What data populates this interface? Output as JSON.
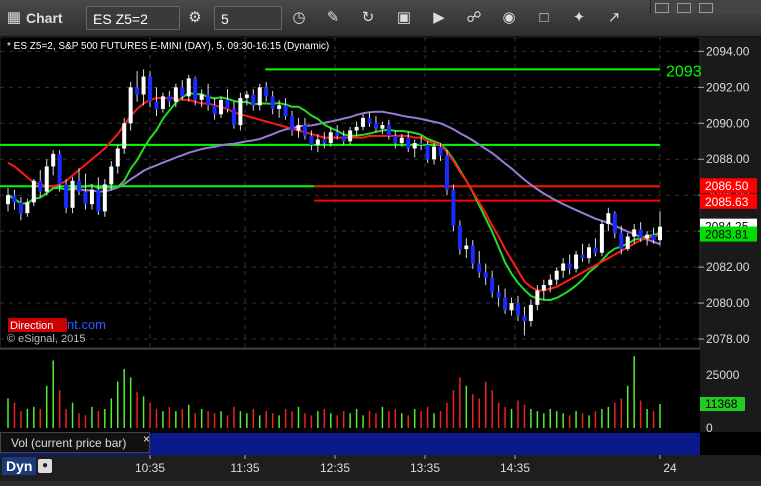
{
  "toolbar": {
    "title": "Chart",
    "symbol": "ES Z5=2",
    "interval": "5",
    "icons": [
      "settings-icon",
      "clock-icon",
      "draw-icon",
      "refresh-icon",
      "quote-icon",
      "play-icon",
      "link-icon",
      "comment-icon",
      "twitter-icon",
      "expand-icon"
    ]
  },
  "chart_data": {
    "type": "candlestick",
    "title": "* ES Z5=2, S&P 500 FUTURES E-MINI (DAY), 5, 09:30-16:15 (Dynamic)",
    "watermark": "© eSignal, 2015",
    "direction_badge": "Direction",
    "direction_badge_suffix": "nt.com",
    "x_tick_labels": [
      "10:35",
      "11:35",
      "12:35",
      "13:35",
      "14:35",
      "24"
    ],
    "y_tick_labels": [
      "2094.00",
      "2092.00",
      "2090.00",
      "2088.00",
      "2086.00",
      "2084.00",
      "2082.00",
      "2080.00",
      "2078.00"
    ],
    "ylim": [
      2077.5,
      2094.8
    ],
    "price_markers": [
      {
        "label": "2093",
        "value": 2093.0,
        "color": "#00ff00"
      },
      {
        "label": "2086.50",
        "value": 2086.5,
        "color": "#ff0000"
      },
      {
        "label": "2085.63",
        "value": 2085.63,
        "color": "#ff0000"
      },
      {
        "label": "2084.25",
        "value": 2084.25,
        "color": "#ffffff"
      },
      {
        "label": "2083.81",
        "value": 2083.81,
        "color": "#00dd00"
      }
    ],
    "horizontal_levels": [
      {
        "value": 2093.0,
        "color": "#00ff00",
        "from": 0.38
      },
      {
        "value": 2088.8,
        "color": "#00ff00",
        "from": 0.0
      },
      {
        "value": 2086.5,
        "color": "#00ff00",
        "from": 0.0
      },
      {
        "value": 2086.5,
        "color": "#ff0000",
        "from": 0.45
      },
      {
        "value": 2085.7,
        "color": "#ff0000",
        "from": 0.45
      }
    ],
    "candles": [
      [
        2085.5,
        2086.4,
        2085.1,
        2086.0
      ],
      [
        2086.0,
        2086.3,
        2085.2,
        2085.6
      ],
      [
        2085.6,
        2085.9,
        2084.6,
        2085.0
      ],
      [
        2085.0,
        2085.8,
        2084.8,
        2085.6
      ],
      [
        2085.6,
        2086.9,
        2085.4,
        2086.8
      ],
      [
        2086.8,
        2087.4,
        2085.9,
        2086.2
      ],
      [
        2086.2,
        2088.0,
        2086.0,
        2087.6
      ],
      [
        2087.6,
        2088.5,
        2087.1,
        2088.3
      ],
      [
        2088.3,
        2088.5,
        2086.2,
        2086.6
      ],
      [
        2086.6,
        2086.9,
        2085.0,
        2085.3
      ],
      [
        2085.3,
        2087.0,
        2085.0,
        2086.8
      ],
      [
        2086.8,
        2087.5,
        2086.0,
        2086.2
      ],
      [
        2086.2,
        2087.2,
        2085.2,
        2085.5
      ],
      [
        2085.5,
        2086.6,
        2085.2,
        2086.3
      ],
      [
        2086.3,
        2087.0,
        2084.9,
        2085.1
      ],
      [
        2085.1,
        2086.9,
        2084.8,
        2086.6
      ],
      [
        2086.6,
        2087.9,
        2086.3,
        2087.6
      ],
      [
        2087.6,
        2088.8,
        2087.2,
        2088.6
      ],
      [
        2088.6,
        2090.3,
        2088.3,
        2090.0
      ],
      [
        2090.0,
        2092.3,
        2089.6,
        2092.0
      ],
      [
        2092.0,
        2092.9,
        2091.2,
        2091.6
      ],
      [
        2091.6,
        2093.0,
        2091.0,
        2092.6
      ],
      [
        2092.6,
        2092.9,
        2090.9,
        2091.2
      ],
      [
        2091.2,
        2092.0,
        2090.4,
        2090.8
      ],
      [
        2090.8,
        2091.7,
        2090.6,
        2091.5
      ],
      [
        2091.5,
        2091.8,
        2090.9,
        2091.2
      ],
      [
        2091.2,
        2092.2,
        2090.9,
        2092.0
      ],
      [
        2092.0,
        2092.4,
        2091.3,
        2091.5
      ],
      [
        2091.5,
        2092.7,
        2091.2,
        2092.5
      ],
      [
        2092.5,
        2092.6,
        2091.0,
        2091.3
      ],
      [
        2091.3,
        2091.9,
        2090.9,
        2091.6
      ],
      [
        2091.6,
        2092.2,
        2090.7,
        2091.0
      ],
      [
        2091.0,
        2091.4,
        2090.2,
        2090.5
      ],
      [
        2090.5,
        2091.5,
        2090.3,
        2091.3
      ],
      [
        2091.3,
        2091.9,
        2090.6,
        2090.8
      ],
      [
        2090.8,
        2091.2,
        2089.7,
        2089.9
      ],
      [
        2089.9,
        2091.7,
        2089.6,
        2091.4
      ],
      [
        2091.4,
        2091.8,
        2091.0,
        2091.6
      ],
      [
        2091.6,
        2091.9,
        2090.7,
        2091.0
      ],
      [
        2091.0,
        2092.2,
        2090.7,
        2092.0
      ],
      [
        2092.0,
        2092.3,
        2091.2,
        2091.5
      ],
      [
        2091.5,
        2091.8,
        2090.5,
        2090.8
      ],
      [
        2090.8,
        2091.3,
        2090.3,
        2091.0
      ],
      [
        2091.0,
        2091.4,
        2090.2,
        2090.4
      ],
      [
        2090.4,
        2090.7,
        2089.3,
        2089.6
      ],
      [
        2089.6,
        2090.3,
        2089.2,
        2089.9
      ],
      [
        2089.9,
        2090.3,
        2089.1,
        2089.3
      ],
      [
        2089.3,
        2089.6,
        2088.5,
        2088.8
      ],
      [
        2088.8,
        2089.4,
        2088.4,
        2089.1
      ],
      [
        2089.1,
        2089.5,
        2088.6,
        2088.9
      ],
      [
        2088.9,
        2089.8,
        2088.7,
        2089.5
      ],
      [
        2089.5,
        2089.9,
        2089.1,
        2089.3
      ],
      [
        2089.3,
        2089.6,
        2088.8,
        2089.0
      ],
      [
        2089.0,
        2089.8,
        2088.8,
        2089.6
      ],
      [
        2089.6,
        2090.1,
        2089.3,
        2089.8
      ],
      [
        2089.8,
        2090.5,
        2089.6,
        2090.3
      ],
      [
        2090.3,
        2090.6,
        2089.8,
        2090.0
      ],
      [
        2090.0,
        2090.4,
        2089.5,
        2089.7
      ],
      [
        2089.7,
        2090.1,
        2089.4,
        2089.9
      ],
      [
        2089.9,
        2090.2,
        2089.1,
        2089.3
      ],
      [
        2089.3,
        2089.6,
        2088.6,
        2088.9
      ],
      [
        2088.9,
        2089.4,
        2088.7,
        2089.2
      ],
      [
        2089.2,
        2089.5,
        2088.4,
        2088.6
      ],
      [
        2088.6,
        2089.1,
        2088.1,
        2088.9
      ],
      [
        2088.9,
        2089.3,
        2088.5,
        2088.8
      ],
      [
        2088.8,
        2089.0,
        2087.8,
        2088.0
      ],
      [
        2088.0,
        2088.9,
        2087.7,
        2088.7
      ],
      [
        2088.7,
        2088.9,
        2087.9,
        2088.2
      ],
      [
        2088.2,
        2088.5,
        2086.0,
        2086.3
      ],
      [
        2086.3,
        2086.6,
        2084.0,
        2084.3
      ],
      [
        2084.3,
        2084.6,
        2082.7,
        2083.0
      ],
      [
        2083.0,
        2083.6,
        2082.5,
        2083.2
      ],
      [
        2083.2,
        2083.5,
        2081.9,
        2082.2
      ],
      [
        2082.2,
        2082.9,
        2081.4,
        2081.7
      ],
      [
        2081.7,
        2082.2,
        2081.0,
        2081.4
      ],
      [
        2081.4,
        2081.8,
        2080.3,
        2080.6
      ],
      [
        2080.6,
        2081.0,
        2079.8,
        2080.3
      ],
      [
        2080.3,
        2080.8,
        2079.4,
        2079.6
      ],
      [
        2079.6,
        2080.3,
        2079.3,
        2080.0
      ],
      [
        2080.0,
        2080.4,
        2079.0,
        2079.3
      ],
      [
        2079.3,
        2079.8,
        2078.2,
        2079.0
      ],
      [
        2079.0,
        2080.2,
        2078.7,
        2079.9
      ],
      [
        2079.9,
        2081.0,
        2079.6,
        2080.7
      ],
      [
        2080.7,
        2081.3,
        2080.2,
        2081.0
      ],
      [
        2081.0,
        2081.6,
        2080.6,
        2081.3
      ],
      [
        2081.3,
        2082.0,
        2081.0,
        2081.8
      ],
      [
        2081.8,
        2082.5,
        2081.4,
        2082.2
      ],
      [
        2082.2,
        2082.7,
        2081.6,
        2081.9
      ],
      [
        2081.9,
        2082.9,
        2081.7,
        2082.7
      ],
      [
        2082.7,
        2083.3,
        2082.3,
        2082.5
      ],
      [
        2082.5,
        2083.3,
        2082.2,
        2083.1
      ],
      [
        2083.1,
        2083.6,
        2082.6,
        2082.8
      ],
      [
        2082.8,
        2084.6,
        2082.6,
        2084.4
      ],
      [
        2084.4,
        2085.3,
        2084.0,
        2085.0
      ],
      [
        2085.0,
        2085.1,
        2083.6,
        2083.9
      ],
      [
        2083.9,
        2084.3,
        2082.7,
        2083.0
      ],
      [
        2083.0,
        2083.9,
        2082.9,
        2083.7
      ],
      [
        2083.7,
        2084.4,
        2083.3,
        2084.1
      ],
      [
        2084.1,
        2084.5,
        2083.4,
        2083.6
      ],
      [
        2083.6,
        2084.0,
        2083.2,
        2083.8
      ],
      [
        2083.8,
        2084.2,
        2083.3,
        2083.5
      ],
      [
        2083.5,
        2085.1,
        2083.2,
        2084.25
      ]
    ],
    "ma_fast_red": [
      2087.8,
      2087.6,
      2087.3,
      2087.0,
      2086.7,
      2086.6,
      2086.5,
      2086.5,
      2086.6,
      2086.8,
      2087.1,
      2087.4,
      2087.7,
      2088.0,
      2088.3,
      2088.6,
      2089.0,
      2089.4,
      2089.9,
      2090.4,
      2090.8,
      2091.1,
      2091.3,
      2091.4,
      2091.4,
      2091.4,
      2091.4,
      2091.3,
      2091.3,
      2091.2,
      2091.1,
      2091.1,
      2091.0,
      2090.9,
      2090.8,
      2090.6,
      2090.5,
      2090.4,
      2090.3,
      2090.2,
      2090.1,
      2090.0,
      2089.9,
      2089.8,
      2089.7,
      2089.6,
      2089.5,
      2089.4,
      2089.3,
      2089.2,
      2089.2,
      2089.2,
      2089.2,
      2089.2,
      2089.2,
      2089.2,
      2089.3,
      2089.3,
      2089.3,
      2089.3,
      2089.3,
      2089.3,
      2089.3,
      2089.2,
      2089.2,
      2089.0,
      2088.9,
      2088.8,
      2088.4,
      2087.9,
      2087.3,
      2086.8,
      2086.2,
      2085.6,
      2085.0,
      2084.3,
      2083.7,
      2083.0,
      2082.4,
      2081.8,
      2081.2,
      2080.9,
      2080.7,
      2080.7,
      2080.8,
      2080.9,
      2081.1,
      2081.3,
      2081.5,
      2081.7,
      2081.9,
      2082.1,
      2082.3,
      2082.5,
      2082.7,
      2082.9,
      2083.1,
      2083.3,
      2083.5,
      2083.6,
      2083.7,
      2083.8
    ]
  },
  "volume": {
    "label": "Vol (current price bar)",
    "close_glyph": "×",
    "y_tick_labels": [
      "25000",
      "0"
    ],
    "ylim": [
      0,
      36000
    ],
    "current_value_label": "11368",
    "current_value": 11368,
    "bars": [
      14000,
      12000,
      8000,
      9000,
      10000,
      9000,
      20000,
      32000,
      18000,
      9000,
      12000,
      7000,
      6000,
      10000,
      8000,
      9000,
      14000,
      22000,
      28000,
      24000,
      17000,
      15000,
      12000,
      9000,
      8000,
      10000,
      8000,
      9000,
      11000,
      7000,
      9000,
      8000,
      7000,
      8000,
      6000,
      10000,
      8000,
      7000,
      9000,
      6000,
      8000,
      7000,
      6000,
      9000,
      8000,
      10000,
      7000,
      6000,
      8000,
      9000,
      7000,
      6000,
      8000,
      7000,
      9000,
      6000,
      8000,
      7000,
      10000,
      8000,
      9000,
      7000,
      6000,
      9000,
      8000,
      10000,
      7000,
      8000,
      12000,
      18000,
      24000,
      20000,
      16000,
      14000,
      22000,
      18000,
      12000,
      10000,
      9000,
      13000,
      11000,
      9000,
      8000,
      7000,
      9000,
      8000,
      7000,
      6000,
      8000,
      7000,
      6000,
      8000,
      9000,
      10000,
      12000,
      14000,
      20000,
      34000,
      13000,
      9000,
      8000,
      11368
    ]
  },
  "bottom": {
    "mode_label": "Dyn",
    "lock_icon": "lock-icon"
  }
}
